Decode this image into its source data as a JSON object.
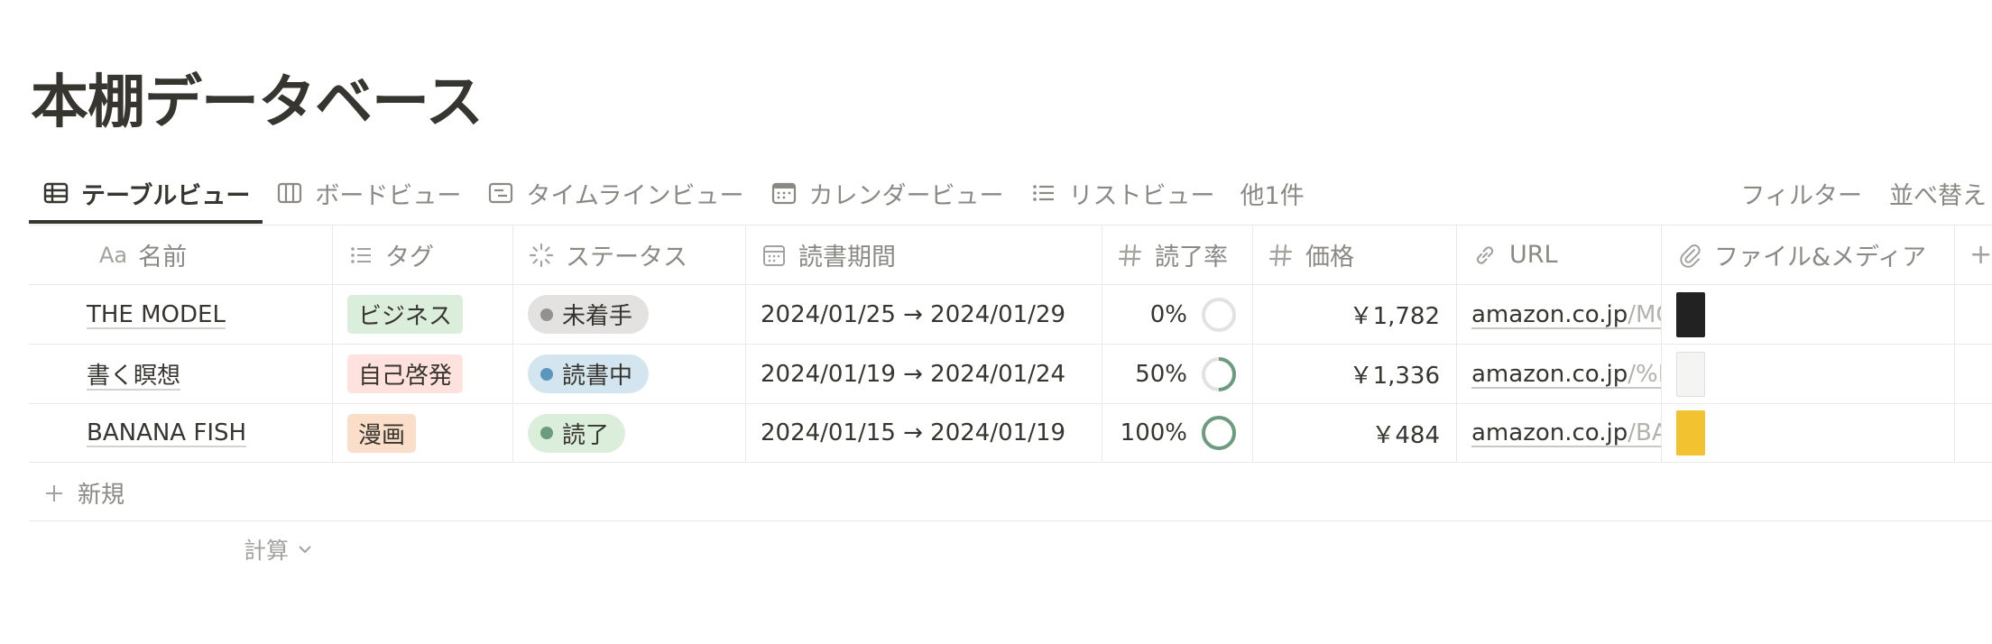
{
  "page_title": "本棚データベース",
  "views": {
    "tabs": [
      {
        "label": "テーブルビュー",
        "active": true
      },
      {
        "label": "ボードビュー",
        "active": false
      },
      {
        "label": "タイムラインビュー",
        "active": false
      },
      {
        "label": "カレンダービュー",
        "active": false
      },
      {
        "label": "リストビュー",
        "active": false
      }
    ],
    "more_label": "他1件",
    "filter_label": "フィルター",
    "sort_label": "並べ替え"
  },
  "table": {
    "columns": {
      "name_prefix": "Aa",
      "name": "名前",
      "tag": "タグ",
      "status": "ステータス",
      "period": "読書期間",
      "rate": "読了率",
      "price": "価格",
      "url": "URL",
      "files": "ファイル&メディア",
      "add": "+"
    },
    "rows": [
      {
        "name": "THE MODEL",
        "tag": "ビジネス",
        "tag_color": "#dbeddb",
        "status": "未着手",
        "status_bg": "#e3e2e0",
        "status_dot": "#91918e",
        "period": "2024/01/25 → 2024/01/29",
        "rate": "0%",
        "rate_value": 0,
        "price": "￥1,782",
        "url_main": "amazon.co.jp",
        "url_rest": "/MO",
        "thumb_color": "#222222"
      },
      {
        "name": "書く瞑想",
        "tag": "自己啓発",
        "tag_color": "#ffe2dd",
        "status": "読書中",
        "status_bg": "#d3e5ef",
        "status_dot": "#5b97bd",
        "period": "2024/01/19 → 2024/01/24",
        "rate": "50%",
        "rate_value": 0.5,
        "price": "￥1,336",
        "url_main": "amazon.co.jp",
        "url_rest": "/%E",
        "thumb_color": "#f4f4f2"
      },
      {
        "name": "BANANA FISH",
        "tag": "漫画",
        "tag_color": "#fadec9",
        "status": "読了",
        "status_bg": "#dbeddb",
        "status_dot": "#6c9b7d",
        "period": "2024/01/15 → 2024/01/19",
        "rate": "100%",
        "rate_value": 1,
        "price": "￥484",
        "url_main": "amazon.co.jp",
        "url_rest": "/BA",
        "thumb_color": "#f2c230"
      }
    ]
  },
  "new_row_label": "新規",
  "calc_label": "計算",
  "colors": {
    "ring_track": "#e3e2e0",
    "ring_fill": "#6c9b7d"
  }
}
